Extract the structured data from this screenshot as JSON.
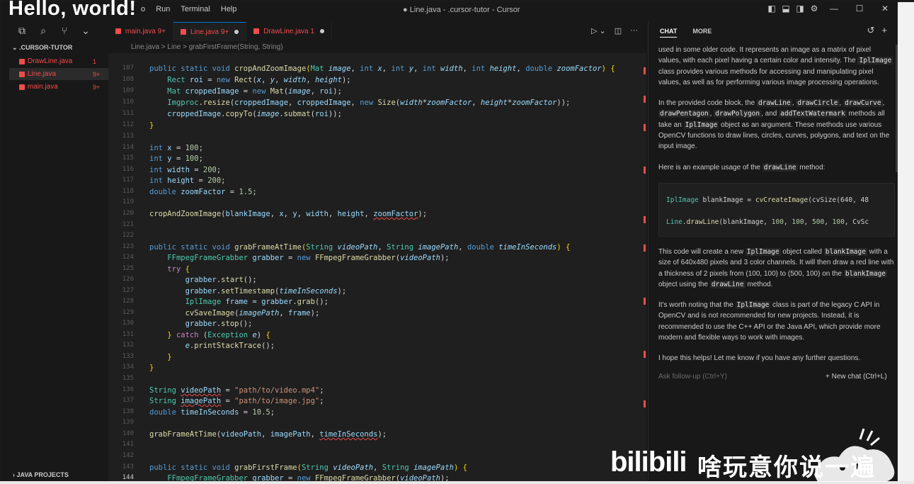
{
  "overlay": {
    "hello": "Hello, world!",
    "bili_logo": "bilibili",
    "bili_text": "啥玩意你说一遍"
  },
  "titlebar": {
    "menu": [
      "o",
      "Run",
      "Terminal",
      "Help"
    ],
    "title": "● Line.java - .cursor-tutor - Cursor"
  },
  "explorer": {
    "root": ".CURSOR-TUTOR",
    "files": [
      {
        "name": "DrawLine.java",
        "badge": "1",
        "color": "#f14c4c",
        "active": false
      },
      {
        "name": "Line.java",
        "badge": "9+",
        "color": "#f14c4c",
        "active": true
      },
      {
        "name": "main.java",
        "badge": "9+",
        "color": "#f14c4c",
        "active": false
      }
    ],
    "bottom": "JAVA PROJECTS"
  },
  "tabs": [
    {
      "label": "main.java",
      "badge": "9+",
      "dot": false,
      "active": false
    },
    {
      "label": "Line.java",
      "badge": "9+",
      "dot": true,
      "active": true
    },
    {
      "label": "DrawLine.java",
      "badge": "1",
      "dot": true,
      "active": false
    }
  ],
  "breadcrumb": "Line.java > Line > grabFirstFrame(String, String)",
  "chat": {
    "tab_chat": "CHAT",
    "tab_more": "MORE",
    "input_placeholder": "Ask follow-up (Ctrl+Y)",
    "new_chat": "New chat (Ctrl+L)"
  },
  "accent": "#0078d4"
}
